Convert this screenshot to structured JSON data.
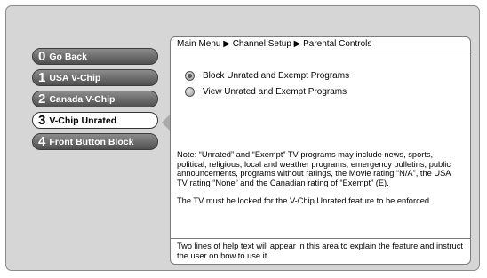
{
  "breadcrumb": {
    "text": "Main Menu ▶ Channel Setup ▶ Parental Controls"
  },
  "menu": {
    "items": [
      {
        "num": "0",
        "label": "Go Back",
        "selected": false
      },
      {
        "num": "1",
        "label": "USA V-Chip",
        "selected": false
      },
      {
        "num": "2",
        "label": "Canada V-Chip",
        "selected": false
      },
      {
        "num": "3",
        "label": "V-Chip Unrated",
        "selected": true
      },
      {
        "num": "4",
        "label": "Front Button Block",
        "selected": false
      }
    ]
  },
  "options": {
    "block_label": "Block Unrated and Exempt Programs",
    "view_label": "View Unrated and Exempt Programs",
    "selected": "block"
  },
  "note": {
    "paragraph1": "Note: “Unrated” and “Exempt” TV programs may include news, sports, political, religious, local and weather programs, emergency bulletins, public announcements, programs without ratings, the Movie rating “N/A”, the USA TV rating “None” and the Canadian rating of “Exempt” (E).",
    "paragraph2": "The TV must be locked for the V-Chip Unrated feature to be enforced"
  },
  "help": {
    "text": "Two lines of help text will appear in this area to explain the feature and instruct the user on how to use it."
  },
  "colors": {
    "background": "#d6d6d6",
    "button_fill": "#6e6e6e",
    "selected_fill": "#ffffff"
  }
}
